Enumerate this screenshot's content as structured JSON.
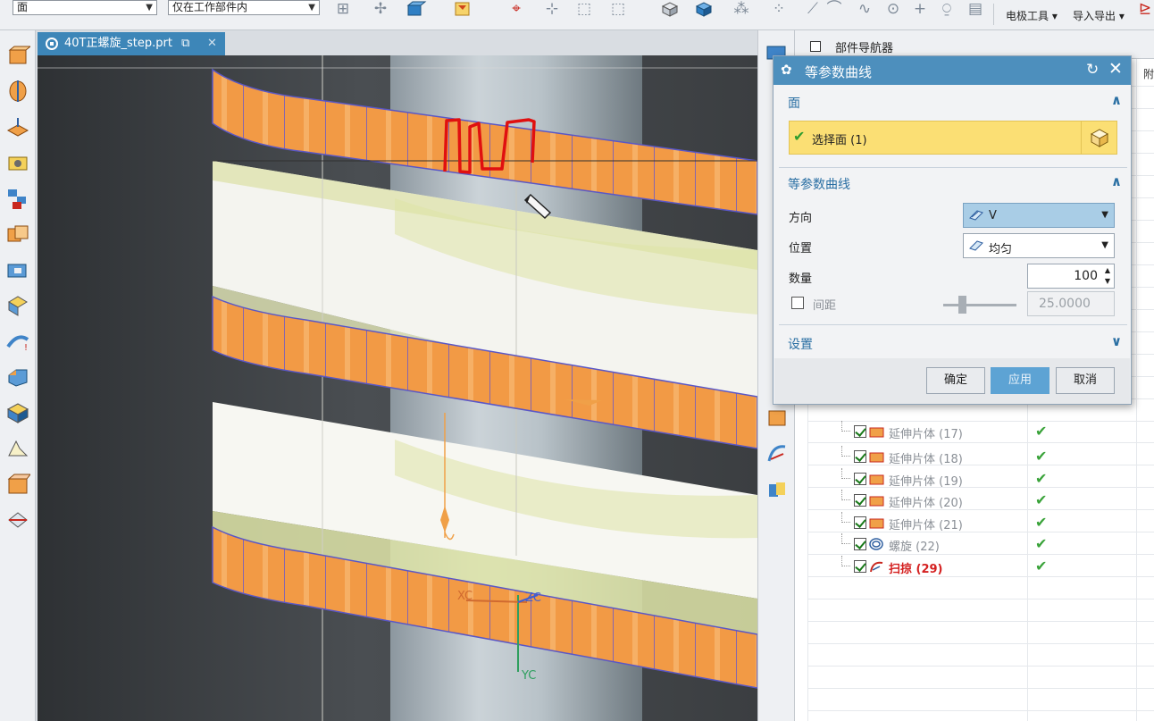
{
  "toolbar": {
    "filter_select": "面",
    "scope_select": "仅在工作部件内",
    "menu_electrode": "电极工具",
    "menu_import_export": "导入导出"
  },
  "tab": {
    "title": "40T正螺旋_step.prt"
  },
  "viewport": {
    "axis_xc": "XC",
    "axis_zc": "ZC",
    "axis_yc": "YC"
  },
  "navigator": {
    "title": "部件导航器",
    "col_fragment": "附",
    "rows": [
      {
        "label": "延伸片体 (17)",
        "status": "ok"
      },
      {
        "label": "延伸片体 (18)",
        "status": "ok"
      },
      {
        "label": "延伸片体 (19)",
        "status": "ok"
      },
      {
        "label": "延伸片体 (20)",
        "status": "ok"
      },
      {
        "label": "延伸片体 (21)",
        "status": "ok"
      },
      {
        "label": "螺旋 (22)",
        "status": "ok"
      },
      {
        "label": "扫掠 (29)",
        "status": "ok"
      }
    ]
  },
  "dialog": {
    "title": "等参数曲线",
    "section_face": "面",
    "select_face": "选择面 (1)",
    "section_curve": "等参数曲线",
    "direction_label": "方向",
    "direction_value": "V",
    "position_label": "位置",
    "position_value": "均匀",
    "count_label": "数量",
    "count_value": "100",
    "spacing_label": "间距",
    "spacing_value": "25.0000",
    "section_settings": "设置",
    "ok_label": "确定",
    "apply_label": "应用",
    "cancel_label": "取消"
  },
  "colors": {
    "accent_blue": "#4d8fbd",
    "selection_yellow": "#fbdf74",
    "band_orange": "#f0a048",
    "annotation_red": "#e01010"
  }
}
